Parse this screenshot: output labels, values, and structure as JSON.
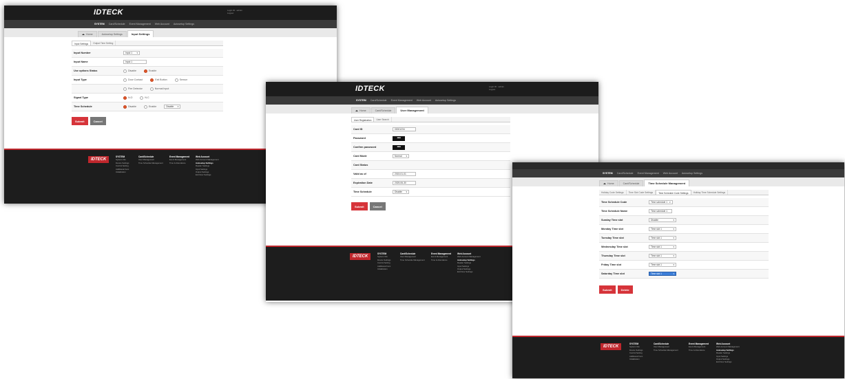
{
  "brand": "IDTECK",
  "user_box": [
    "Login ID : admin",
    "Logout"
  ],
  "menu": [
    "SYSTEM",
    "Card/Schedule",
    "Event Management",
    "Web Account",
    "Autosetup Settings"
  ],
  "footer": {
    "logo": "IDTECK",
    "columns": [
      {
        "title": "SYSTEM",
        "items": [
          "System Info",
          "Device Settings",
          "Control Setting",
          "Additional Func",
          "Initialization"
        ]
      },
      {
        "title": "Card/Schedule",
        "items": [
          "User Management",
          "Time Schedule Management"
        ]
      },
      {
        "title": "Event Management",
        "items": [
          "Event Management",
          "Time & Attendance"
        ]
      },
      {
        "title": "Web Account",
        "items": [
          "Web Account Management"
        ],
        "bold": "Autosetup Settings",
        "extra": [
          "Reader Settings",
          "Input Settings",
          "Output Settings",
          "Exit Door Settings"
        ]
      }
    ]
  },
  "screen1": {
    "crumbs": [
      "Home",
      "Autosetup Settings",
      "Input Settings"
    ],
    "subtabs": [
      "Input Settings",
      "Output Time Setting"
    ],
    "rows": [
      {
        "label": "Input Number",
        "select": "Input 1"
      },
      {
        "label": "Input Name",
        "input": "Input 1"
      },
      {
        "label": "Use options Status",
        "radios": [
          {
            "t": "Disable",
            "on": false
          },
          {
            "t": "Enable",
            "on": true
          }
        ]
      },
      {
        "label": "Input Type",
        "radios": [
          {
            "t": "Door Contact",
            "on": false
          },
          {
            "t": "Exit Button",
            "on": true
          },
          {
            "t": "Sensor",
            "on": false
          }
        ]
      },
      {
        "label": "",
        "radios": [
          {
            "t": "Fire Detector",
            "on": false
          },
          {
            "t": "Normal Input",
            "on": false
          }
        ]
      },
      {
        "label": "Signal Type",
        "radios": [
          {
            "t": "N.O",
            "on": true
          },
          {
            "t": "N.C",
            "on": false
          }
        ]
      },
      {
        "label": "Time Schedule",
        "radios": [
          {
            "t": "Disable",
            "on": true
          },
          {
            "t": "Enable",
            "on": false
          }
        ],
        "select": "Disable"
      }
    ],
    "buttons": [
      "Submit",
      "Cancel"
    ]
  },
  "screen2": {
    "crumbs": [
      "Home",
      "Card/Schedule",
      "User Management"
    ],
    "subtabs": [
      "User Registration",
      "User Search"
    ],
    "rows": [
      {
        "label": "Card ID",
        "input": "00001234"
      },
      {
        "label": "Password",
        "password": "••••"
      },
      {
        "label": "Confirm password",
        "password": "••••"
      },
      {
        "label": "Card Mode",
        "select": "Normal"
      },
      {
        "label": "Card Status"
      },
      {
        "label": "Valid as of",
        "input": "2015-01-01"
      },
      {
        "label": "Expiration Date",
        "input": "2025-06-30"
      },
      {
        "label": "Time Schedule",
        "select": "Disable"
      }
    ],
    "buttons": [
      "Submit",
      "Cancel"
    ]
  },
  "screen3": {
    "crumbs": [
      "Home",
      "Card/Schedule",
      "Time Schedule Management"
    ],
    "subtabs": [
      "Holiday Code Settings",
      "Time Slot Code Settings",
      "Time Schedule Code Settings",
      "Holiday Time Schedule Settings"
    ],
    "rows": [
      {
        "label": "Time Schedule Code",
        "select": "Time schedule 1"
      },
      {
        "label": "Time Schedule Name",
        "input": "Time schedule 1"
      },
      {
        "label": "Sunday Time slot",
        "select": "Disable"
      },
      {
        "label": "Monday Time slot",
        "select": "Time slot 1"
      },
      {
        "label": "Tuesday Time slot",
        "select": "Time slot 1"
      },
      {
        "label": "Wednesday Time slot",
        "select": "Time slot 1"
      },
      {
        "label": "Thursday Time slot",
        "select": "Time slot 1"
      },
      {
        "label": "Friday Time slot",
        "select": "Time slot 1"
      },
      {
        "label": "Saturday Time slot",
        "select": "Time slot 1",
        "highlight": true
      }
    ],
    "buttons": [
      "Submit",
      "Delete"
    ]
  },
  "colors": {
    "accent": "#d6343a",
    "header": "#1c1c1c",
    "menubar": "#3a3a3a",
    "radio_on": "#e05a2a",
    "highlight": "#3d7fd9"
  }
}
